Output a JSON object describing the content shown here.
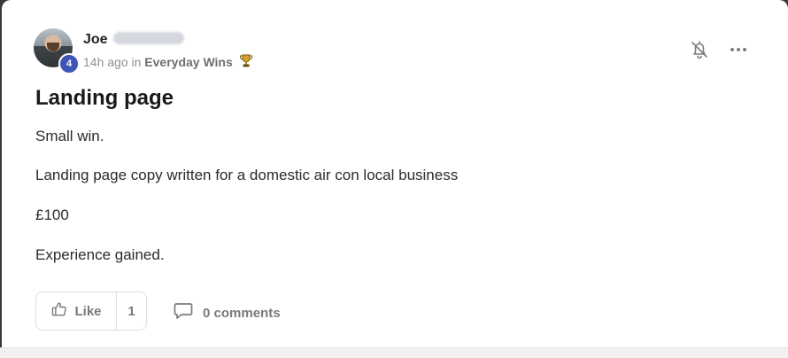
{
  "post": {
    "author": {
      "name": "Joe",
      "level": "4"
    },
    "meta": {
      "time": "14h ago",
      "in_word": "in",
      "category": "Everyday Wins"
    },
    "title": "Landing page",
    "body": [
      "Small win.",
      "Landing page copy written for a domestic air con local business",
      "£100",
      "Experience gained."
    ],
    "actions": {
      "like_label": "Like",
      "like_count": "1",
      "comments_label": "0 comments"
    }
  },
  "icons": {
    "bell": "bell-off-icon",
    "more": "more-horizontal-icon",
    "trophy": "trophy-icon",
    "like": "thumbs-up-icon",
    "comment": "comment-icon"
  },
  "colors": {
    "level_badge": "#3f55b5",
    "trophy": "#c9931b"
  }
}
